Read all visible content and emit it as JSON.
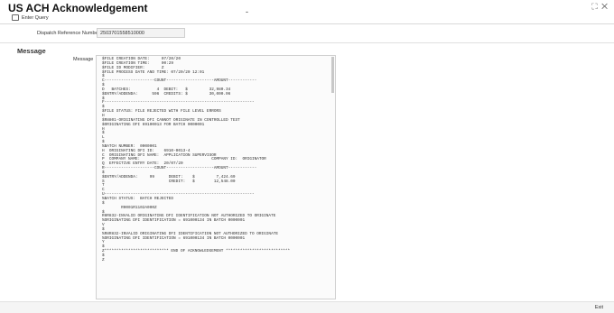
{
  "window": {
    "title": "US ACH Acknowledgement",
    "dash": "-",
    "controls": "⛶ ✕"
  },
  "toolbar": {
    "enter_query_label": "Enter Query"
  },
  "form": {
    "dispatch_reference_label": "Dispatch Reference Number",
    "dispatch_reference_value": "2503701558510000"
  },
  "section": {
    "title": "Message"
  },
  "message": {
    "label": "Message",
    "text": "$FILE CREATION DATE:     07/20/20\n$FILE CREATION TIME:     00:29\n$FILE ID MODIFIER:       Z\n$FILE PROCESS DATE AND TIME: 07/20/20 12:01\n$\nC---------------------COUNT--------------------AMOUNT------------\n$\nD   BATCHES:           4  DEBIT:   $         32,980.34\n$ENTRY/ADDENDA:      596  CREDITS: $         30,000.06\n$\nF---------------------------------------------------------------\n$\n$FILE STATUS: FILE REJECTED WITH FILE LEVEL ERRORS\nH\n$R8801-ORIGINATING DFI CANNOT ORIGINATE IN CONTROLLED TEST\n$ORIGINATING DFI 69100013 FOR BATCH 0000001\nH\n$\nL\n$\n%BATCH NUMBER:  0000001\nH  ORIGINATING DFI ID:    6910-0013-4\nC  ORIGINATING DFI NAME:  APPLICATION SUPERVISOR\nP  COMPANY NAME:                              COMPANY ID:  ORIGINATOR\nQ  EFFECTIVE ENTRY DATE:  20/07/20\nR---------------------COUNT--------------------AMOUNT------------\n$\n$ENTRY/ADDENDA:     99      DEBIT:    $         7,424.69\nS                           CREDIT:   $        12,548.00\nT\nC\nU---------------------------------------------------------------\n%BATCH STATUS:  BATCH REJECTED\n$\n        R0001R1102A000Z\n$\nR8R832-INVALID ORIGINATING DFI IDENTIFICATION NOT AUTHORIZED TO ORIGINATE\n%ORIGINATING DFI IDENTIFICATION = 691000134 IN BATCH 0000001\nV\n$\n%R8R832-INVALID ORIGINATING DFI IDENTIFICATION NOT AUTHORIZED TO ORIGINATE\n%ORIGINATING DFI IDENTIFICATION = 691000134 IN BATCH 0000001\nY\n$\nZ*************************** END OF ACKNOWLEDGEMENT ***************************\n$\nZ"
  },
  "footer": {
    "exit_label": "Exit"
  }
}
